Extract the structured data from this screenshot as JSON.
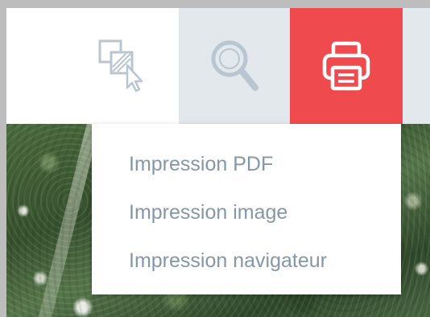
{
  "toolbar": {
    "buttons": [
      {
        "name": "select-tool",
        "icon": "select-area-icon"
      },
      {
        "name": "zoom-tool",
        "icon": "magnifier-icon"
      },
      {
        "name": "print-tool",
        "icon": "printer-icon",
        "active": true
      }
    ]
  },
  "print_menu": {
    "items": [
      {
        "label": "Impression PDF"
      },
      {
        "label": "Impression image"
      },
      {
        "label": "Impression navigateur"
      }
    ]
  },
  "colors": {
    "accent": "#ef4b4e",
    "icon_gray": "#b9c6d2",
    "menu_text": "#8497a8",
    "toolbar_alt_bg": "#e2e8ec"
  }
}
